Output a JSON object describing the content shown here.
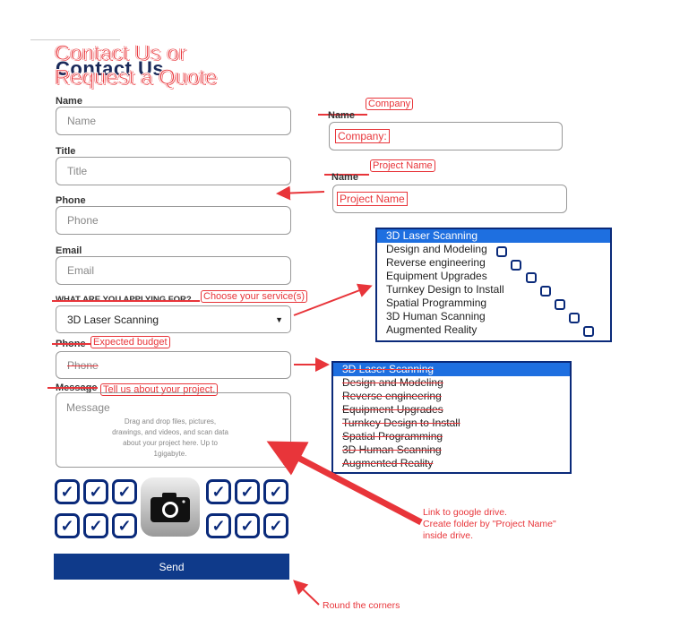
{
  "title": {
    "base": "Contact Us",
    "overlay_line1": "Contact Us or",
    "overlay_line2": "Request a Quote"
  },
  "fields": {
    "name": {
      "label": "Name",
      "placeholder": "Name"
    },
    "title": {
      "label": "Title",
      "placeholder": "Title"
    },
    "phone": {
      "label": "Phone",
      "placeholder": "Phone"
    },
    "email": {
      "label": "Email",
      "placeholder": "Email"
    },
    "service": {
      "label": "WHAT ARE YOU APPLYING FOR?",
      "value": "3D Laser Scanning"
    },
    "budget": {
      "label": "Phone",
      "placeholder": "Phone"
    },
    "message": {
      "label": "Message",
      "placeholder": "Message",
      "hint": "Drag and drop files, pictures, drawings, and videos, and scan data about your project here. Up to 1gigabyte."
    }
  },
  "send_label": "Send",
  "right": {
    "company_label": "Name",
    "company_placeholder": "Company:",
    "company_anno": "Company",
    "project_label": "Name",
    "project_placeholder": "Project Name",
    "project_anno": "Project Name"
  },
  "annotations": {
    "services": "Choose your service(s)",
    "budget": "Expected budget",
    "message": "Tell us about your project.",
    "drive_line1": "Link to google drive.",
    "drive_line2": "Create folder by \"Project Name\"",
    "drive_line3": "inside drive.",
    "corners": "Round the corners"
  },
  "services_list": [
    "3D Laser Scanning",
    "Design and Modeling",
    "Reverse engineering",
    "Equipment Upgrades",
    "Turnkey Design to Install",
    "Spatial Programming",
    "3D Human Scanning",
    "Augmented Reality"
  ],
  "budget_list": [
    "3D Laser Scanning",
    "Design and Modeling",
    "Reverse engineering",
    "Equipment Upgrades",
    "Turnkey Design to Install",
    "Spatial Programming",
    "3D Human Scanning",
    "Augmented Reality"
  ],
  "colors": {
    "accent": "#e8353a",
    "navy": "#0a2a7a",
    "button": "#0f3a8a",
    "select_blue": "#1e6fe0"
  }
}
